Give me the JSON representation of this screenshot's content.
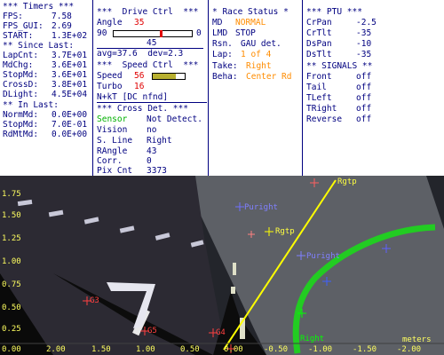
{
  "timers": {
    "title": "*** Timers ***",
    "fps_label": "FPS:",
    "fps_value": "7.58",
    "fpsgui_label": "FPS_GUI:",
    "fpsgui_value": "2.69",
    "start_label": "START:",
    "start_value": "1.3E+02",
    "since_header": "** Since Last:",
    "lapcnt_label": "LapCnt:",
    "lapcnt_value": "3.7E+01",
    "mdchg_label": "MdChg:",
    "mdchg_value": "3.6E+01",
    "stopmd_label": "StopMd:",
    "stopmd_value": "3.6E+01",
    "crossd_label": "CrossD:",
    "crossd_value": "3.8E+01",
    "dlight_label": "DLight:",
    "dlight_value": "4.5E+04",
    "inlast_header": "** In Last:",
    "normmd_label": "NormMd:",
    "normmd_value": "0.0E+00",
    "stopmd2_label": "StopMd:",
    "stopmd2_value": "7.0E-01",
    "rdmtmd_label": "RdMtMd:",
    "rdmtmd_value": "0.0E+00"
  },
  "drive": {
    "title": "***  Drive Ctrl  ***",
    "angle_label": "Angle",
    "angle_value": "35",
    "gauge_min": "90",
    "gauge_max": "0",
    "gauge_level_percent": 61,
    "gauge_mid": "45",
    "avg_text": "avg=37.6  dev=2.3",
    "speed_header": "***  Speed Ctrl  ***",
    "speed_label": "Speed",
    "speed_value": "56",
    "speed_level_percent": 72,
    "turbo_label": "Turbo",
    "turbo_value": "16",
    "nkt_text": "N+kT [DC nfnd]",
    "cross_header": "*** Cross Det. ***",
    "sensor_label": "Sensor",
    "sensor_value": "Not Detect.",
    "vision_label": "Vision",
    "vision_value": "no",
    "sline_label": "S. Line",
    "sline_value": "Right",
    "rangle_label": "RAngle",
    "rangle_value": "43",
    "corr_label": "Corr.",
    "corr_value": "0",
    "pixcnt_label": "Pix Cnt",
    "pixcnt_value": "3373"
  },
  "race": {
    "title": "* Race Status *",
    "md_label": "MD",
    "md_value": "NORMAL",
    "lmd_label": "LMD",
    "lmd_value": "STOP",
    "rsn_label": "Rsn.",
    "rsn_value": "GAU det.",
    "lap_label": "Lap:",
    "lap_value": "1 of 4",
    "take_label": "Take:",
    "take_value": "Right",
    "beha_label": "Beha:",
    "beha_value": "Center Rd"
  },
  "ptu": {
    "title": "*** PTU ***",
    "crpan_label": "CrPan",
    "crpan_value": "-2.5",
    "crtlt_label": "CrTlt",
    "crtlt_value": "-35",
    "dspan_label": "DsPan",
    "dspan_value": "-10",
    "dstlt_label": "DsTlt",
    "dstlt_value": "-35",
    "signals_header": "** SIGNALS **",
    "front_label": "Front",
    "front_value": "off",
    "tail_label": "Tail",
    "tail_value": "off",
    "tleft_label": "TLeft",
    "tleft_value": "off",
    "tright_label": "TRight",
    "tright_value": "off",
    "reverse_label": "Reverse",
    "reverse_value": "off"
  },
  "camera": {
    "y_ticks": [
      "1.75",
      "1.50",
      "1.25",
      "1.00",
      "0.75",
      "0.50",
      "0.25"
    ],
    "x_ticks": [
      "0.00",
      "2.00",
      "1.50",
      "1.00",
      "0.50",
      "0.00",
      "-0.50",
      "-1.00",
      "-1.50",
      "-2.00"
    ],
    "units_label": "meters",
    "markers": {
      "rgtp_top": "Rgtp",
      "rgtp_mid": "Rgtp",
      "purple_1": "Puright",
      "purple_2": "Puright",
      "g3": "G3",
      "g5": "G5",
      "g4": "G4",
      "right": "Right"
    }
  }
}
